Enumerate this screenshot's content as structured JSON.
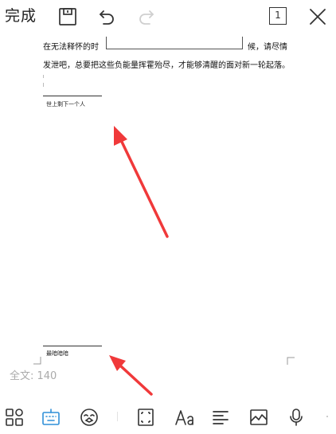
{
  "toolbar": {
    "done_label": "完成",
    "page_indicator": "1"
  },
  "document": {
    "line1_left": "在无法释怀的时",
    "line1_right": "候，请尽情",
    "line2": "发泄吧，总要把这些负能量挥霍殆尽，才能够清醒的面对新一轮起落。",
    "snippet1": "世上剩下一个人",
    "snippet2": "最暗暗暗"
  },
  "status": {
    "word_count": "全文: 140"
  },
  "colors": {
    "arrow": "#f0393a",
    "active_icon": "#2f8fd8"
  },
  "bottom_icons": [
    "apps-icon",
    "keyboard-icon",
    "emoji-icon",
    "fullscreen-icon",
    "font-icon",
    "align-icon",
    "image-icon",
    "microphone-icon"
  ]
}
